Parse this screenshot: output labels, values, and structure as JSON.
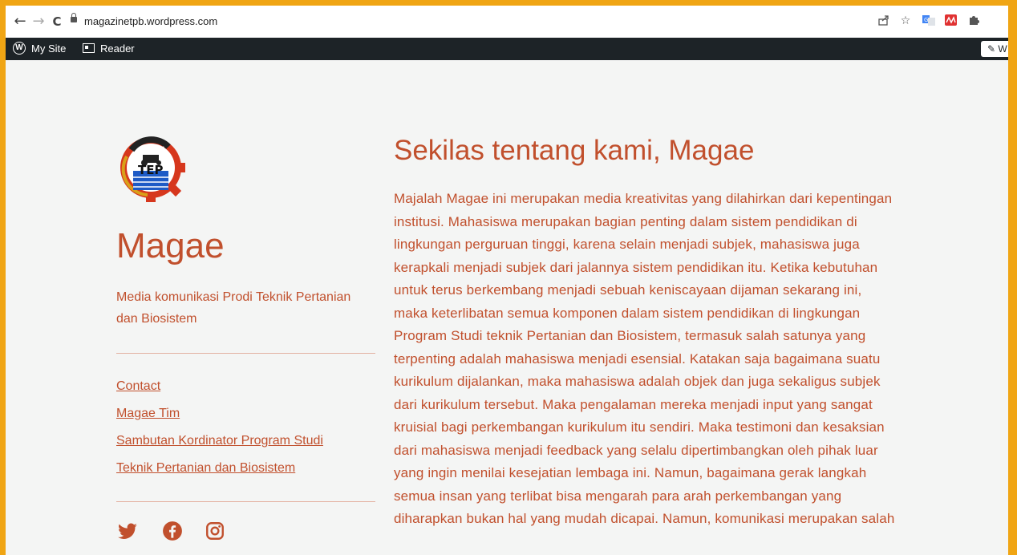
{
  "browser": {
    "back_icon": "←",
    "forward_icon": "→",
    "reload_icon": "C",
    "url": "magazinetpb.wordpress.com"
  },
  "adminbar": {
    "my_site": "My Site",
    "reader": "Reader",
    "write": "W"
  },
  "site": {
    "title": "Magae",
    "description": "Media komunikasi Prodi Teknik Pertanian dan Biosistem",
    "logo_text_top": "HIMATETA",
    "logo_text": "TEP",
    "menu": [
      {
        "label": "Contact"
      },
      {
        "label": "Magae Tim"
      },
      {
        "label": "Sambutan Kordinator Program Studi"
      },
      {
        "label": "Teknik Pertanian dan Biosistem"
      }
    ],
    "social": [
      "twitter-icon",
      "facebook-icon",
      "instagram-icon"
    ]
  },
  "post": {
    "title": "Sekilas tentang kami, Magae",
    "lines": [
      "Majalah Magae ini merupakan media kreativitas yang dilahirkan dari kepentingan",
      "institusi. Mahasiswa merupakan bagian penting dalam sistem pendidikan di",
      "lingkungan perguruan tinggi, karena selain menjadi subjek, mahasiswa juga",
      "kerapkali menjadi subjek dari jalannya sistem pendidikan itu. Ketika kebutuhan",
      "untuk terus berkembang menjadi sebuah keniscayaan dijaman sekarang ini,",
      "maka keterlibatan semua komponen dalam sistem pendidikan di lingkungan",
      "Program Studi teknik Pertanian dan Biosistem, termasuk salah satunya yang",
      "terpenting adalah mahasiswa menjadi esensial. Katakan saja bagaimana suatu",
      "kurikulum dijalankan, maka mahasiswa adalah objek dan juga sekaligus subjek",
      "dari kurikulum tersebut. Maka pengalaman mereka menjadi input yang sangat",
      "kruisial bagi perkembangan kurikulum itu sendiri. Maka testimoni dan kesaksian",
      "dari mahasiswa menjadi feedback yang selalu dipertimbangkan oleh pihak luar",
      "yang ingin menilai kesejatian lembaga ini. Namun, bagaimana gerak langkah",
      "semua insan yang terlibat bisa mengarah para arah perkembangan yang",
      "diharapkan bukan hal yang mudah dicapai. Namun, komunikasi merupakan salah"
    ]
  },
  "colors": {
    "accent": "#c1502d",
    "background": "#f4f5f4",
    "adminbar": "#1d2327",
    "frame": "#f0a514"
  }
}
